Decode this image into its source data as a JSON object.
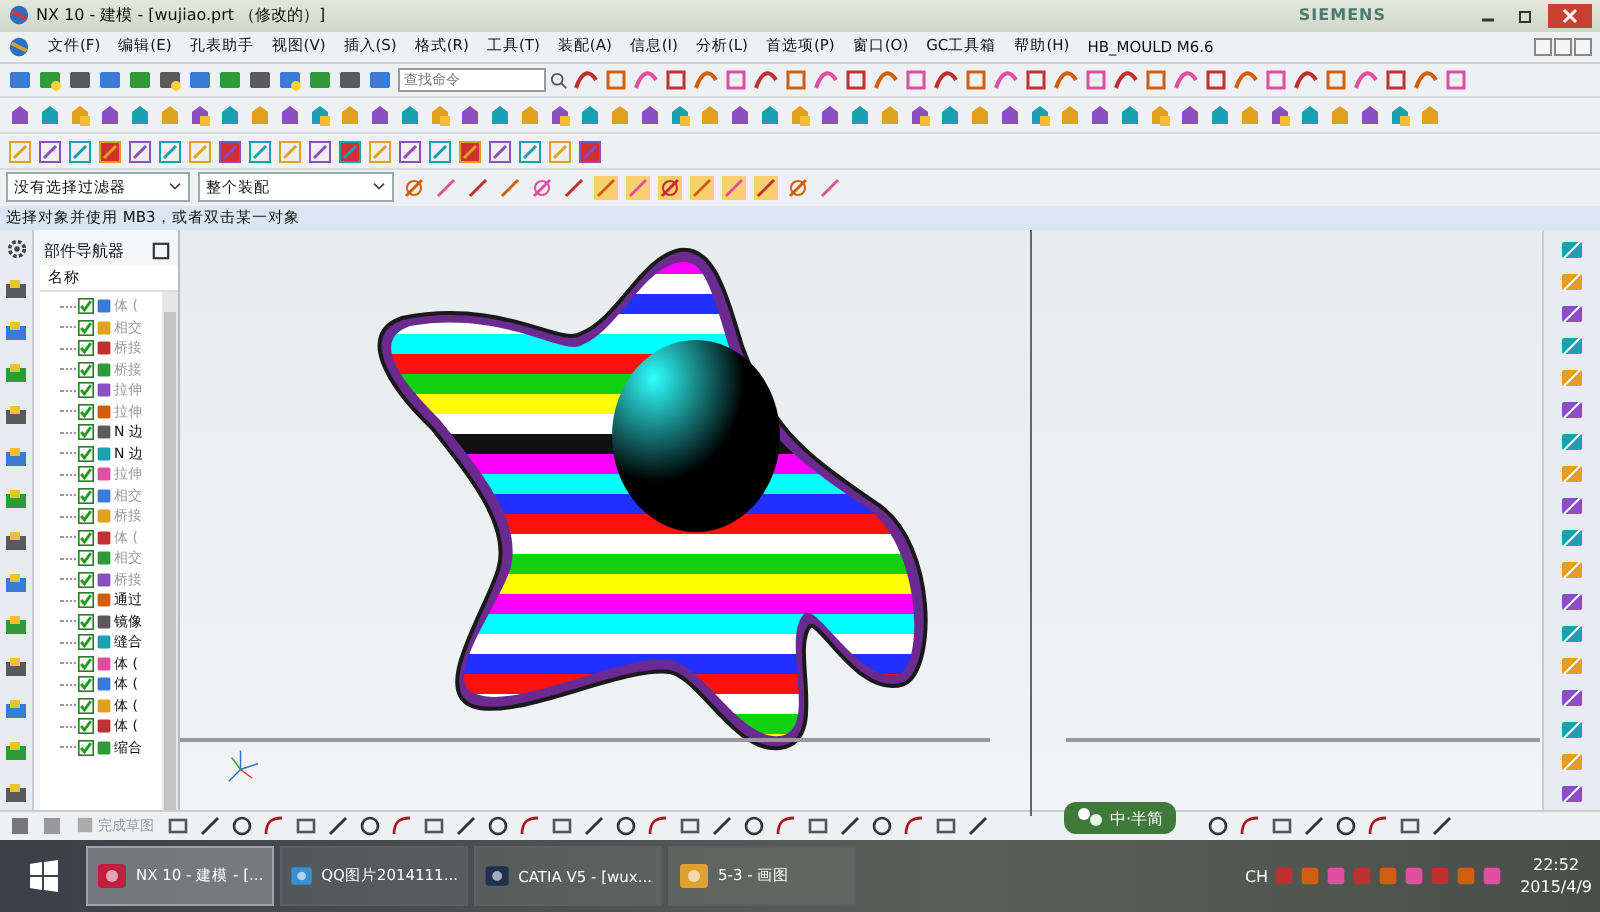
{
  "window": {
    "title": "NX 10 - 建模 - [wujiao.prt （修改的）]",
    "brand": "SIEMENS"
  },
  "menu": [
    "文件(F)",
    "编辑(E)",
    "孔表助手",
    "视图(V)",
    "插入(S)",
    "格式(R)",
    "工具(T)",
    "装配(A)",
    "信息(I)",
    "分析(L)",
    "首选项(P)",
    "窗口(O)",
    "GC工具箱",
    "帮助(H)",
    "HB_MOULD M6.6"
  ],
  "search": {
    "placeholder": "查找命令"
  },
  "filters": [
    {
      "value": "没有选择过滤器"
    },
    {
      "value": "整个装配"
    }
  ],
  "status_line": "选择对象并使用 MB3，或者双击某一对象",
  "navigator": {
    "title": "部件导航器",
    "column": "名称",
    "items": [
      {
        "label": "体 (",
        "checked": true,
        "dimmed": true
      },
      {
        "label": "相交",
        "checked": true,
        "dimmed": true
      },
      {
        "label": "桥接",
        "checked": true,
        "dimmed": true
      },
      {
        "label": "桥接",
        "checked": true,
        "dimmed": true
      },
      {
        "label": "拉伸",
        "checked": true,
        "dimmed": true
      },
      {
        "label": "拉伸",
        "checked": true,
        "dimmed": true
      },
      {
        "label": "N 边",
        "checked": true,
        "dimmed": false
      },
      {
        "label": "N 边",
        "checked": true,
        "dimmed": false
      },
      {
        "label": "拉伸",
        "checked": true,
        "dimmed": true
      },
      {
        "label": "相交",
        "checked": true,
        "dimmed": true
      },
      {
        "label": "桥接",
        "checked": true,
        "dimmed": true
      },
      {
        "label": "体 (",
        "checked": true,
        "dimmed": true
      },
      {
        "label": "相交",
        "checked": true,
        "dimmed": true
      },
      {
        "label": "桥接",
        "checked": true,
        "dimmed": true
      },
      {
        "label": "通过",
        "checked": true,
        "dimmed": false
      },
      {
        "label": "镜像",
        "checked": true,
        "dimmed": false
      },
      {
        "label": "缝合",
        "checked": true,
        "dimmed": false
      },
      {
        "label": "体 (",
        "checked": true,
        "dimmed": false
      },
      {
        "label": "体 (",
        "checked": true,
        "dimmed": false
      },
      {
        "label": "体 (",
        "checked": true,
        "dimmed": false
      },
      {
        "label": "体 (",
        "checked": true,
        "dimmed": false
      },
      {
        "label": "缩合",
        "checked": true,
        "dimmed": false
      }
    ]
  },
  "sketch_toolbar": {
    "finish_label": "完成草图"
  },
  "ime": {
    "label": "中·半简"
  },
  "taskbar": {
    "tasks": [
      {
        "label": "NX 10 - 建模 - [...",
        "selected": true
      },
      {
        "label": "QQ图片2014111...",
        "selected": false
      },
      {
        "label": "CATIA V5 - [wux...",
        "selected": false
      },
      {
        "label": "5-3 - 画图",
        "selected": false
      }
    ],
    "language": "CH",
    "time": "22:52",
    "date": "2015/4/9"
  }
}
